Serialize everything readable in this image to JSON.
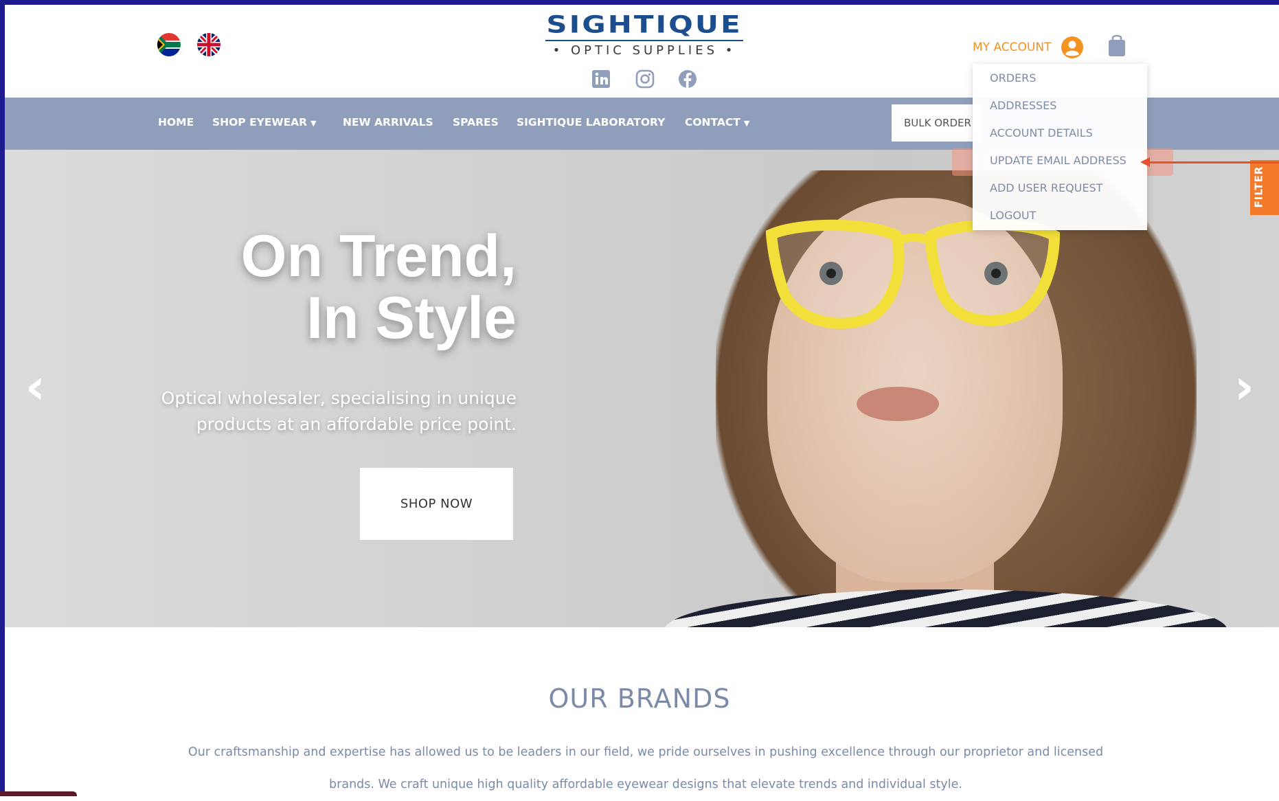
{
  "logo": {
    "title": "SIGHTIQUE",
    "subtitle": "• OPTIC SUPPLIES •"
  },
  "flags": [
    "south-africa-flag-icon",
    "uk-flag-icon"
  ],
  "social": [
    "linkedin-icon",
    "instagram-icon",
    "facebook-icon"
  ],
  "account": {
    "label": "MY ACCOUNT",
    "icon": "user-circle-icon",
    "cart_icon": "shopping-bag-icon"
  },
  "nav": {
    "items": [
      {
        "label": "HOME",
        "dropdown": false
      },
      {
        "label": "SHOP EYEWEAR",
        "dropdown": true
      },
      {
        "label": "NEW ARRIVALS",
        "dropdown": false
      },
      {
        "label": "SPARES",
        "dropdown": false
      },
      {
        "label": "SIGHTIQUE LABORATORY",
        "dropdown": false
      },
      {
        "label": "CONTACT",
        "dropdown": true
      }
    ],
    "bulk_order": "BULK ORDER"
  },
  "account_menu": {
    "items": [
      "ORDERS",
      "ADDRESSES",
      "ACCOUNT DETAILS",
      "UPDATE EMAIL ADDRESS",
      "ADD USER REQUEST",
      "LOGOUT"
    ],
    "highlighted": "UPDATE EMAIL ADDRESS"
  },
  "hero": {
    "heading_line1": "On Trend,",
    "heading_line2": "In Style",
    "subtext_line1": "Optical wholesaler, specialising in unique",
    "subtext_line2": "products at an affordable price point.",
    "button": "SHOP NOW"
  },
  "filter_tab": "FILTER",
  "brands": {
    "title": "OUR BRANDS",
    "line1": "Our craftsmanship and expertise has allowed us to be leaders in our field, we pride ourselves in pushing excellence through our proprietor and licensed",
    "line2": "brands. We craft unique high quality affordable eyewear designs  that elevate trends and individual style."
  },
  "colors": {
    "accent": "#f39322",
    "nav": "#8f9fbb",
    "brand_blue": "#1c4e8f",
    "text_muted": "#7a8aa8",
    "annotation": "#e8502a"
  }
}
